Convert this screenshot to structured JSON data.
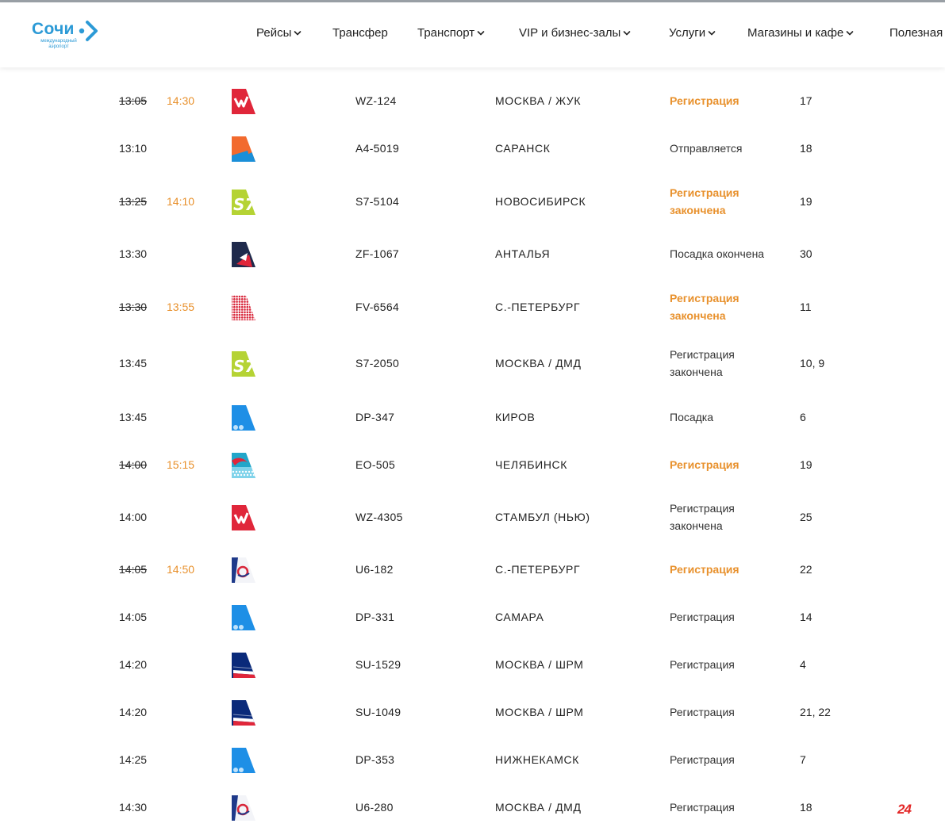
{
  "header": {
    "logo_title": "Сочи",
    "logo_subtitle": "международный аэропорт",
    "nav": [
      {
        "label": "Рейсы",
        "dropdown": true
      },
      {
        "label": "Трансфер",
        "dropdown": false
      },
      {
        "label": "Транспорт",
        "dropdown": true
      },
      {
        "label": "VIP и бизнес-залы",
        "dropdown": true
      },
      {
        "label": "Услуги",
        "dropdown": true
      },
      {
        "label": "Магазины и кафе",
        "dropdown": true
      },
      {
        "label": "Полезная",
        "dropdown": false
      }
    ]
  },
  "colors": {
    "accent": "#e8912d",
    "brand": "#2c9ad6"
  },
  "flights": [
    {
      "time": "13:05",
      "new_time": "14:30",
      "airline_icon": "nordwind-tail-icon",
      "flight": "WZ-124",
      "destination": "МОСКВА / ЖУК",
      "status": "Регистрация",
      "highlight": true,
      "gate": "17"
    },
    {
      "time": "13:10",
      "new_time": "",
      "airline_icon": "azur-air-tail-icon",
      "flight": "A4-5019",
      "destination": "САРАНСК",
      "status": "Отправляется",
      "highlight": false,
      "gate": "18"
    },
    {
      "time": "13:25",
      "new_time": "14:10",
      "airline_icon": "s7-tail-icon",
      "flight": "S7-5104",
      "destination": "НОВОСИБИРСК",
      "status": "Регистрация закончена",
      "highlight": true,
      "gate": "19"
    },
    {
      "time": "13:30",
      "new_time": "",
      "airline_icon": "southwind-tail-icon",
      "flight": "ZF-1067",
      "destination": "АНТАЛЬЯ",
      "status": "Посадка окончена",
      "highlight": false,
      "gate": "30"
    },
    {
      "time": "13:30",
      "new_time": "13:55",
      "airline_icon": "rossiya-tail-icon",
      "flight": "FV-6564",
      "destination": "С.-ПЕТЕРБУРГ",
      "status": "Регистрация закончена",
      "highlight": true,
      "gate": "11"
    },
    {
      "time": "13:45",
      "new_time": "",
      "airline_icon": "s7-tail-icon",
      "flight": "S7-2050",
      "destination": "МОСКВА / ДМД",
      "status": "Регистрация закончена",
      "highlight": false,
      "gate": "10, 9"
    },
    {
      "time": "13:45",
      "new_time": "",
      "airline_icon": "pobeda-tail-icon",
      "flight": "DP-347",
      "destination": "КИРОВ",
      "status": "Посадка",
      "highlight": false,
      "gate": "6"
    },
    {
      "time": "14:00",
      "new_time": "15:15",
      "airline_icon": "pegas-tail-icon",
      "flight": "EO-505",
      "destination": "ЧЕЛЯБИНСК",
      "status": "Регистрация",
      "highlight": true,
      "gate": "19"
    },
    {
      "time": "14:00",
      "new_time": "",
      "airline_icon": "nordwind-tail-icon",
      "flight": "WZ-4305",
      "destination": "СТАМБУЛ (НЬЮ)",
      "status": "Регистрация закончена",
      "highlight": false,
      "gate": "25"
    },
    {
      "time": "14:05",
      "new_time": "14:50",
      "airline_icon": "ural-airlines-tail-icon",
      "flight": "U6-182",
      "destination": "С.-ПЕТЕРБУРГ",
      "status": "Регистрация",
      "highlight": true,
      "gate": "22"
    },
    {
      "time": "14:05",
      "new_time": "",
      "airline_icon": "pobeda-tail-icon",
      "flight": "DP-331",
      "destination": "САМАРА",
      "status": "Регистрация",
      "highlight": false,
      "gate": "14"
    },
    {
      "time": "14:20",
      "new_time": "",
      "airline_icon": "aeroflot-tail-icon",
      "flight": "SU-1529",
      "destination": "МОСКВА / ШРМ",
      "status": "Регистрация",
      "highlight": false,
      "gate": "4"
    },
    {
      "time": "14:20",
      "new_time": "",
      "airline_icon": "aeroflot-tail-icon",
      "flight": "SU-1049",
      "destination": "МОСКВА / ШРМ",
      "status": "Регистрация",
      "highlight": false,
      "gate": "21, 22"
    },
    {
      "time": "14:25",
      "new_time": "",
      "airline_icon": "pobeda-tail-icon",
      "flight": "DP-353",
      "destination": "НИЖНЕКАМСК",
      "status": "Регистрация",
      "highlight": false,
      "gate": "7"
    },
    {
      "time": "14:30",
      "new_time": "",
      "airline_icon": "ural-airlines-tail-icon",
      "flight": "U6-280",
      "destination": "МОСКВА / ДМД",
      "status": "Регистрация",
      "highlight": false,
      "gate": "18"
    }
  ],
  "corner_badge": "24"
}
